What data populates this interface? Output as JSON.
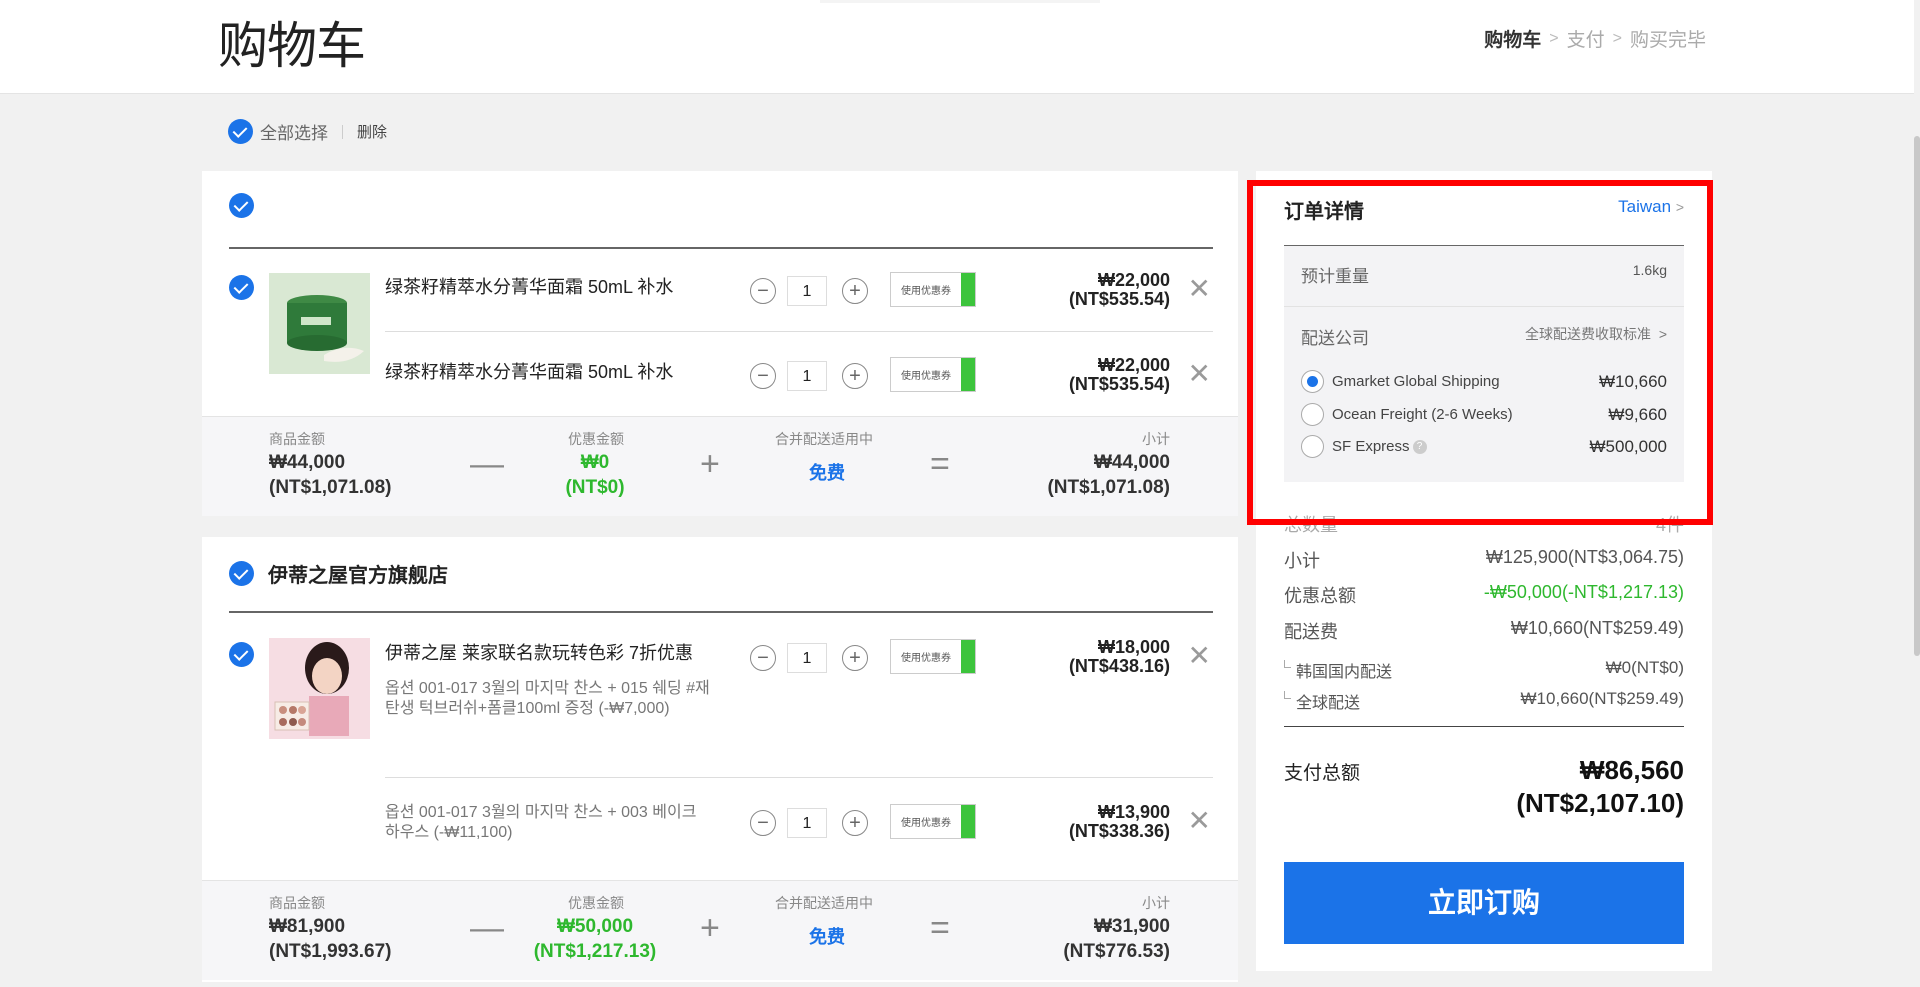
{
  "header": {
    "title": "购物车",
    "steps": [
      "购物车",
      "支付",
      "购买完毕"
    ]
  },
  "selection": {
    "select_all": "全部选择",
    "delete": "删除"
  },
  "stores": [
    {
      "name": "",
      "items": [
        {
          "name": "绿茶籽精萃水分菁华面霜 50mL 补水",
          "qty": "1",
          "coupon": "使用优惠券",
          "price": "₩22,000",
          "price_local": "(NT$535.54)"
        },
        {
          "name": "绿茶籽精萃水分菁华面霜 50mL 补水",
          "qty": "1",
          "coupon": "使用优惠券",
          "price": "₩22,000",
          "price_local": "(NT$535.54)"
        }
      ],
      "summary": {
        "goods_label": "商品金额",
        "goods": "₩44,000",
        "goods_local": "(NT$1,071.08)",
        "discount_label": "优惠金额",
        "discount": "₩0",
        "discount_local": "(NT$0)",
        "shipping_label": "合并配送适用中",
        "shipping": "免费",
        "subtotal_label": "小计",
        "subtotal": "₩44,000",
        "subtotal_local": "(NT$1,071.08)"
      }
    },
    {
      "name": "伊蒂之屋官方旗舰店",
      "items": [
        {
          "name": "伊蒂之屋 莱家联名款玩转色彩 7折优惠",
          "option": "옵션 001-017 3월의 마지막 찬스 + 015 쉐딩 #재탄생 턱브러쉬+폼클100ml 증정 (-₩7,000)",
          "qty": "1",
          "coupon": "使用优惠券",
          "price": "₩18,000",
          "price_local": "(NT$438.16)"
        },
        {
          "option": "옵션 001-017 3월의 마지막 찬스 + 003 베이크 하우스 (-₩11,100)",
          "qty": "1",
          "coupon": "使用优惠券",
          "price": "₩13,900",
          "price_local": "(NT$338.36)"
        }
      ],
      "summary": {
        "goods_label": "商品金额",
        "goods": "₩81,900",
        "goods_local": "(NT$1,993.67)",
        "discount_label": "优惠金额",
        "discount": "₩50,000",
        "discount_local": "(NT$1,217.13)",
        "shipping_label": "合并配送适用中",
        "shipping": "免费",
        "subtotal_label": "小计",
        "subtotal": "₩31,900",
        "subtotal_local": "(NT$776.53)"
      }
    }
  ],
  "order": {
    "title": "订单详情",
    "country": "Taiwan",
    "weight_label": "预计重量",
    "weight": "1.6kg",
    "carrier_label": "配送公司",
    "carrier_link": "全球配送费收取标准",
    "carriers": [
      {
        "name": "Gmarket Global Shipping",
        "price": "₩10,660",
        "selected": true
      },
      {
        "name": "Ocean Freight (2-6 Weeks)",
        "price": "₩9,660",
        "selected": false
      },
      {
        "name": "SF Express",
        "price": "₩500,000",
        "selected": false
      }
    ],
    "total_qty_label": "总数量",
    "total_qty": "4件",
    "subtotal_label": "小计",
    "subtotal": "₩125,900(NT$3,064.75)",
    "discount_label": "优惠总额",
    "discount": "-₩50,000(-NT$1,217.13)",
    "shipping_label": "配送费",
    "shipping": "₩10,660(NT$259.49)",
    "domestic_label": "韩国国内配送",
    "domestic": "₩0(NT$0)",
    "global_label": "全球配送",
    "global": "₩10,660(NT$259.49)",
    "pay_label": "支付总额",
    "pay": "₩86,560",
    "pay_local": "(NT$2,107.10)",
    "order_button": "立即订购"
  },
  "colors": {
    "accent": "#1b73e8",
    "discount": "#2eb82e",
    "highlight": "#ff0000"
  }
}
